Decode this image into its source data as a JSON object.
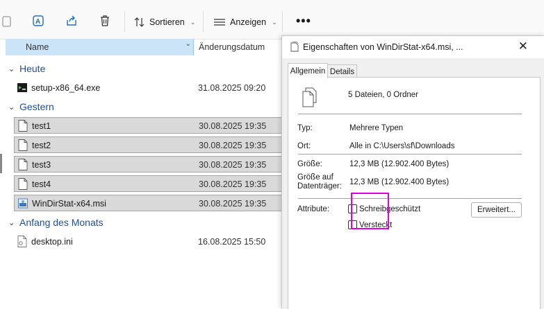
{
  "toolbar": {
    "sort_label": "Sortieren",
    "view_label": "Anzeigen",
    "more_label": "•••"
  },
  "columns": {
    "name": "Name",
    "date": "Änderungsdatum"
  },
  "groups": [
    {
      "label": "Heute"
    },
    {
      "label": "Gestern"
    },
    {
      "label": "Anfang des Monats"
    }
  ],
  "files": [
    {
      "name": "setup-x86_64.exe",
      "date": "31.08.2025 09:20",
      "icon": "exe-setup-icon",
      "selected": false
    },
    {
      "name": "test1",
      "date": "30.08.2025 19:35",
      "icon": "file-icon",
      "selected": true
    },
    {
      "name": "test2",
      "date": "30.08.2025 19:35",
      "icon": "file-icon",
      "selected": true
    },
    {
      "name": "test3",
      "date": "30.08.2025 19:35",
      "icon": "file-icon",
      "selected": true
    },
    {
      "name": "test4",
      "date": "30.08.2025 19:35",
      "icon": "file-icon",
      "selected": true
    },
    {
      "name": "WinDirStat-x64.msi",
      "date": "30.08.2025 19:35",
      "icon": "msi-installer-icon",
      "selected": true
    },
    {
      "name": "desktop.ini",
      "date": "16.08.2025 15:50",
      "icon": "settings-file-icon",
      "selected": false
    }
  ],
  "dialog": {
    "title": "Eigenschaften von WinDirStat-x64.msi, ...",
    "close": "✕",
    "tabs": [
      {
        "label": "Allgemein",
        "active": true
      },
      {
        "label": "Details",
        "active": false
      }
    ],
    "summary": "5 Dateien, 0 Ordner",
    "type_label": "Typ:",
    "type_value": "Mehrere Typen",
    "location_label": "Ort:",
    "location_value": "Alle in C:\\Users\\sf\\Downloads",
    "size_label": "Größe:",
    "size_value": "12,3 MB (12.902.400 Bytes)",
    "disk_size_label_1": "Größe auf",
    "disk_size_label_2": "Datenträger:",
    "disk_size_value": "12,3 MB (12.902.400 Bytes)",
    "attributes_label": "Attribute:",
    "readonly_label": "Schreibgeschützt",
    "readonly_checked": false,
    "hidden_label": "Versteckt",
    "hidden_checked": false,
    "advanced_button": "Erweitert..."
  },
  "colors": {
    "accent": "#1f4e9c",
    "highlight": "#e000e0",
    "header_selected": "#cce4f7",
    "row_selected": "#d9d9d9"
  }
}
